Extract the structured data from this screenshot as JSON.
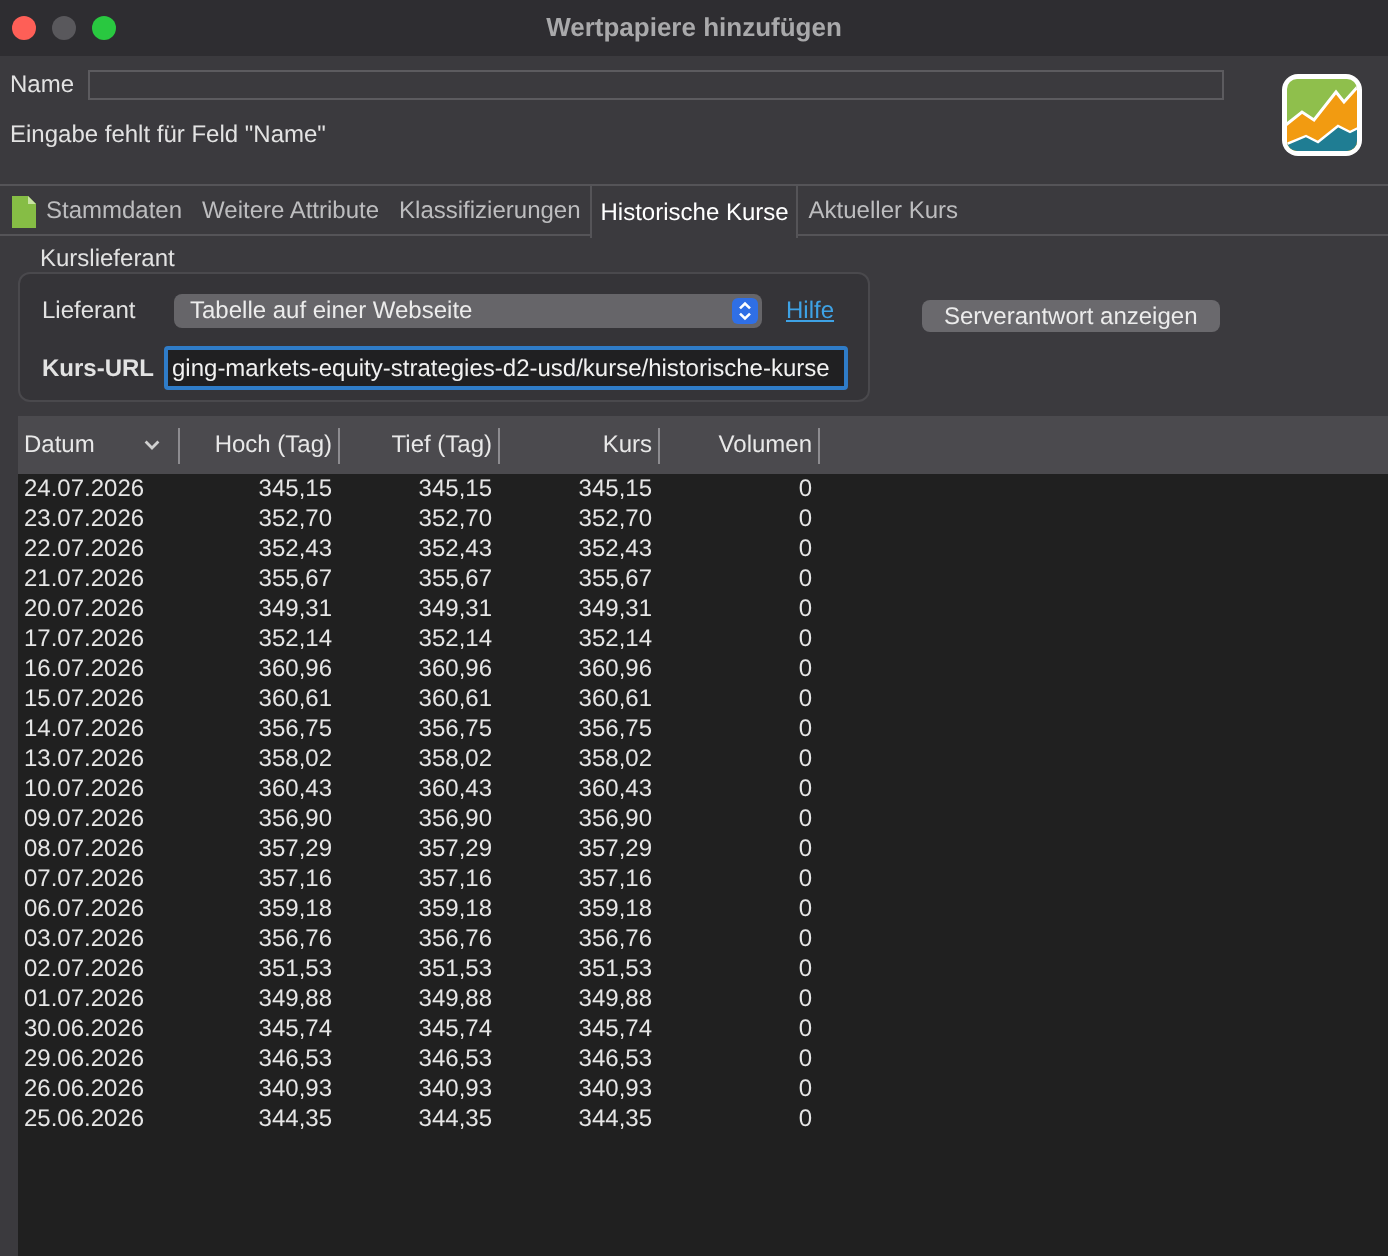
{
  "window": {
    "title": "Wertpapiere hinzufügen"
  },
  "name_field": {
    "label": "Name"
  },
  "validation_message": "Eingabe fehlt für Feld \"Name\"",
  "tabs": [
    {
      "label": "Stammdaten",
      "selected": false,
      "kind": "icon"
    },
    {
      "label": "Weitere Attribute",
      "selected": false,
      "kind": "plain"
    },
    {
      "label": "Klassifizierungen",
      "selected": false,
      "kind": "plain"
    },
    {
      "label": "Historische Kurse",
      "selected": true,
      "kind": "plain"
    },
    {
      "label": "Aktueller Kurs",
      "selected": false,
      "kind": "plain"
    }
  ],
  "quote_provider": {
    "title": "Kurslieferant",
    "provider": {
      "label": "Lieferant",
      "value": "Tabelle auf einer Webseite"
    },
    "help_link": "Hilfe",
    "url": {
      "label": "Kurs-URL",
      "value": "ging-markets-equity-strategies-d2-usd/kurse/historische-kurse",
      "focused": true
    }
  },
  "server_response_button": "Serverantwort anzeigen",
  "table": {
    "columns": [
      {
        "label": "Datum",
        "sorted": true
      },
      {
        "label": "Hoch (Tag)",
        "sorted": false
      },
      {
        "label": "Tief (Tag)",
        "sorted": false
      },
      {
        "label": "Kurs",
        "sorted": false
      },
      {
        "label": "Volumen",
        "sorted": false
      }
    ],
    "rows": [
      [
        "24.07.2026",
        "345,15",
        "345,15",
        "345,15",
        "0"
      ],
      [
        "23.07.2026",
        "352,70",
        "352,70",
        "352,70",
        "0"
      ],
      [
        "22.07.2026",
        "352,43",
        "352,43",
        "352,43",
        "0"
      ],
      [
        "21.07.2026",
        "355,67",
        "355,67",
        "355,67",
        "0"
      ],
      [
        "20.07.2026",
        "349,31",
        "349,31",
        "349,31",
        "0"
      ],
      [
        "17.07.2026",
        "352,14",
        "352,14",
        "352,14",
        "0"
      ],
      [
        "16.07.2026",
        "360,96",
        "360,96",
        "360,96",
        "0"
      ],
      [
        "15.07.2026",
        "360,61",
        "360,61",
        "360,61",
        "0"
      ],
      [
        "14.07.2026",
        "356,75",
        "356,75",
        "356,75",
        "0"
      ],
      [
        "13.07.2026",
        "358,02",
        "358,02",
        "358,02",
        "0"
      ],
      [
        "10.07.2026",
        "360,43",
        "360,43",
        "360,43",
        "0"
      ],
      [
        "09.07.2026",
        "356,90",
        "356,90",
        "356,90",
        "0"
      ],
      [
        "08.07.2026",
        "357,29",
        "357,29",
        "357,29",
        "0"
      ],
      [
        "07.07.2026",
        "357,16",
        "357,16",
        "357,16",
        "0"
      ],
      [
        "06.07.2026",
        "359,18",
        "359,18",
        "359,18",
        "0"
      ],
      [
        "03.07.2026",
        "356,76",
        "356,76",
        "356,76",
        "0"
      ],
      [
        "02.07.2026",
        "351,53",
        "351,53",
        "351,53",
        "0"
      ],
      [
        "01.07.2026",
        "349,88",
        "349,88",
        "349,88",
        "0"
      ],
      [
        "30.06.2026",
        "345,74",
        "345,74",
        "345,74",
        "0"
      ],
      [
        "29.06.2026",
        "346,53",
        "346,53",
        "346,53",
        "0"
      ],
      [
        "26.06.2026",
        "340,93",
        "340,93",
        "340,93",
        "0"
      ],
      [
        "25.06.2026",
        "344,35",
        "344,35",
        "344,35",
        "0"
      ]
    ]
  }
}
